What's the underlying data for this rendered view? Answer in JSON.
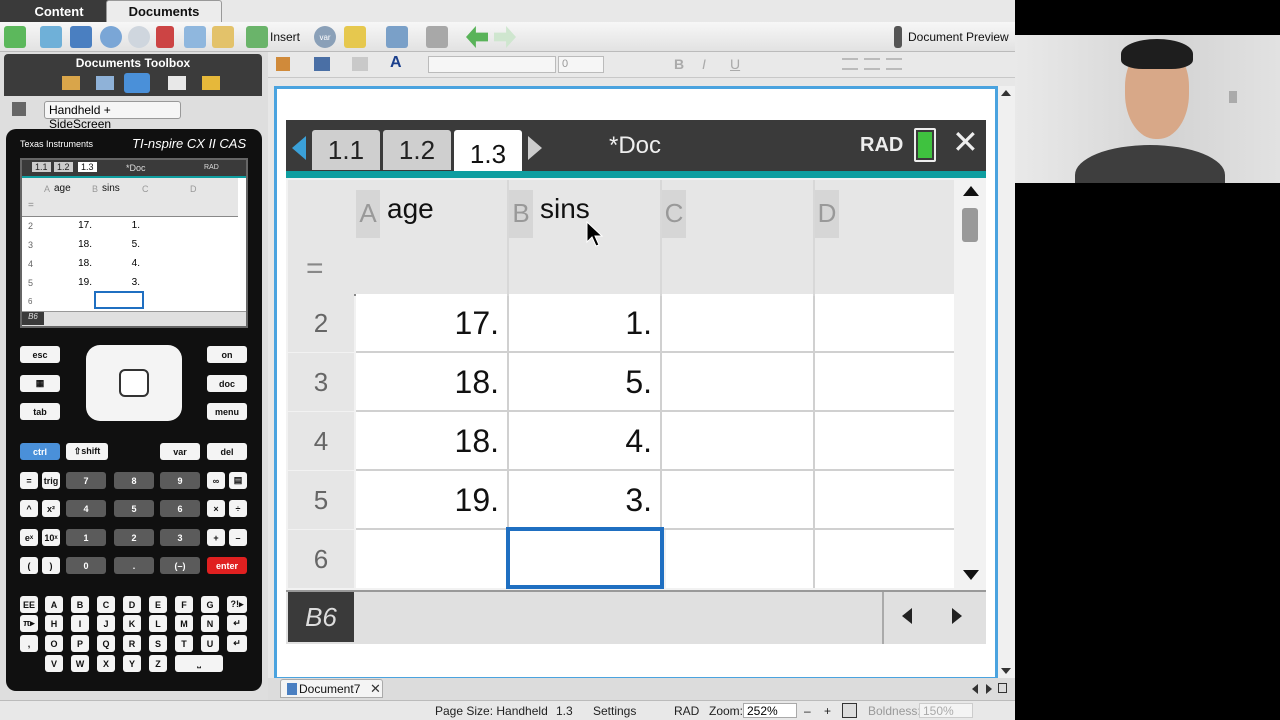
{
  "top_tabs": {
    "content": "Content",
    "documents": "Documents"
  },
  "toolbar": {
    "insert_label": "Insert",
    "var_label": "var",
    "document_preview": "Document Preview"
  },
  "format_toolbar": {
    "font_size": "0"
  },
  "toolbox": {
    "title": "Documents Toolbox",
    "view_mode": "Handheld + SideScreen"
  },
  "calculator": {
    "brand": "Texas Instruments",
    "model": "TI-nspire CX II CAS",
    "mini": {
      "tabs": [
        "1.1",
        "1.2",
        "1.3"
      ],
      "doc": "*Doc",
      "mode": "RAD",
      "columns": [
        {
          "letter": "A",
          "name": "age"
        },
        {
          "letter": "B",
          "name": "sins"
        },
        {
          "letter": "C",
          "name": ""
        },
        {
          "letter": "D",
          "name": ""
        }
      ],
      "rows": [
        {
          "n": "2",
          "a": "17.",
          "b": "1."
        },
        {
          "n": "3",
          "a": "18.",
          "b": "5."
        },
        {
          "n": "4",
          "a": "18.",
          "b": "4."
        },
        {
          "n": "5",
          "a": "19.",
          "b": "3."
        },
        {
          "n": "6",
          "a": "",
          "b": ""
        }
      ],
      "cellref": "B6"
    },
    "keys": {
      "esc": "esc",
      "on": "on",
      "doc": "doc",
      "tab": "tab",
      "menu": "menu",
      "ctrl": "ctrl",
      "shift": "⇧shift",
      "var": "var",
      "del": "del",
      "enter": "enter",
      "trig": "trig",
      "digits": [
        "7",
        "8",
        "9",
        "4",
        "5",
        "6",
        "1",
        "2",
        "3",
        "0",
        "."
      ],
      "neg": "(–)",
      "ops": [
        "×",
        "÷",
        "+",
        "–"
      ],
      "letters": [
        "EE",
        "A",
        "B",
        "C",
        "D",
        "E",
        "F",
        "G",
        "?!▸",
        "π▸",
        "H",
        "I",
        "J",
        "K",
        "L",
        "M",
        "N",
        "↵",
        "O",
        "P",
        "Q",
        "R",
        "S",
        "T",
        "U",
        "↵",
        "V",
        "W",
        "X",
        "Y",
        "Z",
        "⎵"
      ]
    }
  },
  "handheld": {
    "page_tabs": [
      "1.1",
      "1.2",
      "1.3"
    ],
    "doc_title": "*Doc",
    "angle_mode": "RAD",
    "formula_symbol": "=",
    "columns": [
      {
        "letter": "A",
        "name": "age"
      },
      {
        "letter": "B",
        "name": "sins"
      },
      {
        "letter": "C",
        "name": ""
      },
      {
        "letter": "D",
        "name": ""
      }
    ],
    "rows": [
      {
        "n": "2",
        "a": "17.",
        "b": "1."
      },
      {
        "n": "3",
        "a": "18.",
        "b": "5."
      },
      {
        "n": "4",
        "a": "18.",
        "b": "4."
      },
      {
        "n": "5",
        "a": "19.",
        "b": "3."
      },
      {
        "n": "6",
        "a": "",
        "b": ""
      }
    ],
    "cell_ref": "B6"
  },
  "doc_tab": {
    "name": "Document7"
  },
  "status": {
    "page_size": "Page Size: Handheld",
    "page": "1.3",
    "settings": "Settings",
    "mode": "RAD",
    "zoom_label": "Zoom:",
    "zoom_value": "252%",
    "boldness_label": "Boldness:",
    "boldness_value": "150%"
  },
  "colors": {
    "accent": "#4aa3df",
    "teal": "#0f9ea0",
    "selection": "#1f6fc1",
    "battery": "#3fc23f"
  }
}
